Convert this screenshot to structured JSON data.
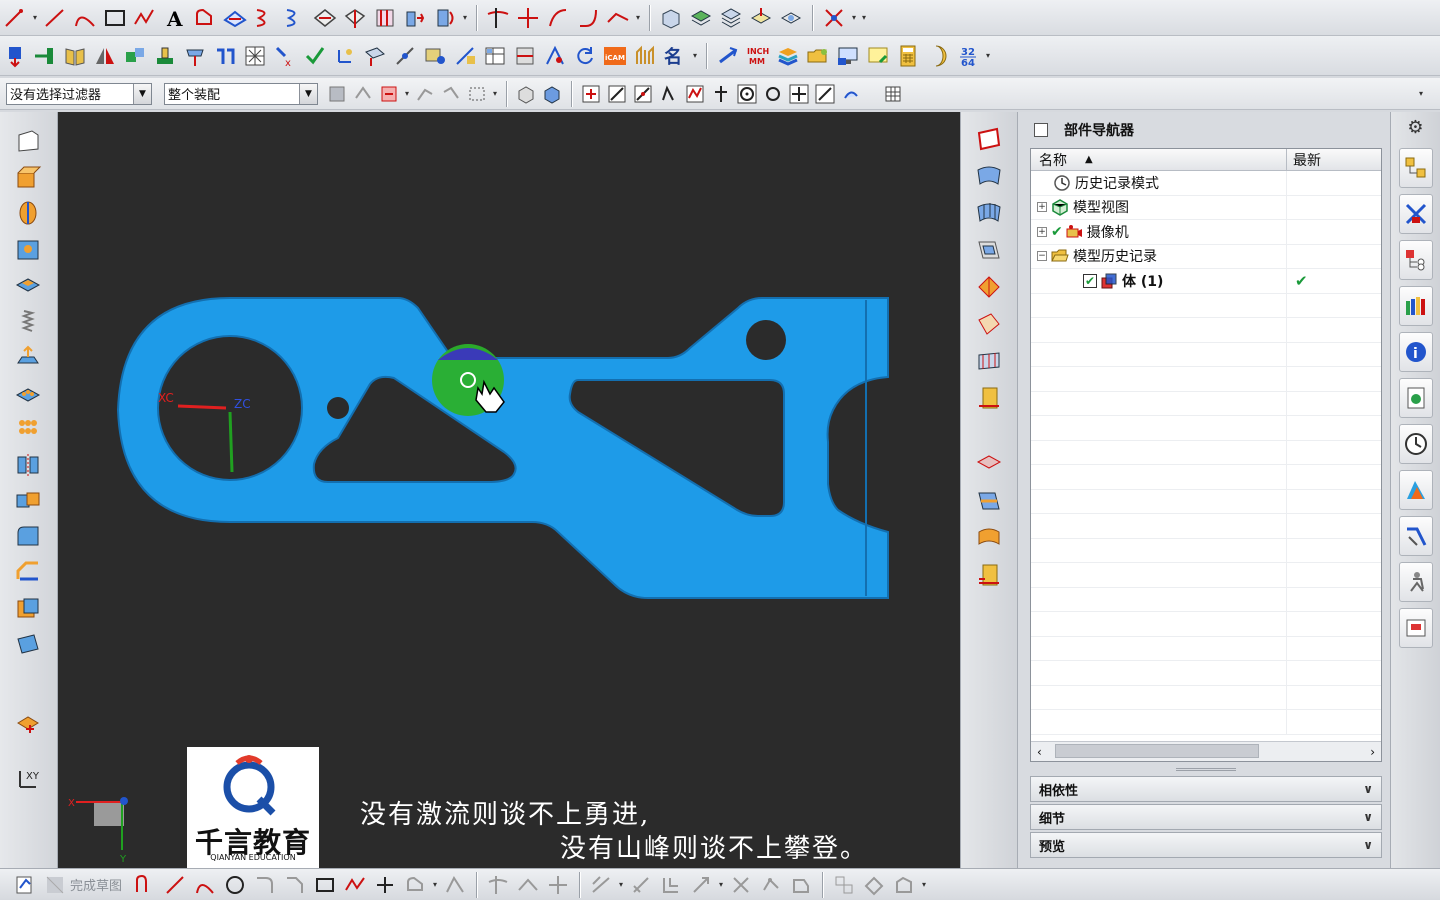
{
  "filters": {
    "selection_filter": "没有选择过滤器",
    "scope": "整个装配"
  },
  "navigator": {
    "title": "部件导航器",
    "columns": {
      "name": "名称",
      "latest": "最新"
    },
    "nodes": [
      {
        "label": "历史记录模式",
        "icon": "clock-icon",
        "expander": ""
      },
      {
        "label": "模型视图",
        "icon": "model-view-icon",
        "expander": "+"
      },
      {
        "label": "摄像机",
        "icon": "camera-icon",
        "expander": "+"
      },
      {
        "label": "模型历史记录",
        "icon": "folder-open-icon",
        "expander": "−"
      },
      {
        "label": "体 (1)",
        "icon": "body-feature-icon",
        "expander": "",
        "latest": "✔"
      }
    ],
    "panels": [
      "相依性",
      "细节",
      "预览"
    ]
  },
  "viewport": {
    "axis_x_label": "XC",
    "axis_z_label": "ZC",
    "background": "#2b2b2b",
    "part_color": "#1e9be8",
    "mini_triad_x": "X",
    "mini_triad_y": "Y"
  },
  "logo": {
    "name": "千言教育",
    "sub": "QIANYAN EDUCATION"
  },
  "subtitles": {
    "line1": "没有激流则谈不上勇进,",
    "line2": "没有山峰则谈不上攀登。"
  },
  "bottom_bar": {
    "finish_sketch": "完成草图"
  },
  "toolbar": {
    "icam_label": "iCAM",
    "inch_label": "INCH",
    "mm_label": "MM",
    "name_label": "名"
  }
}
